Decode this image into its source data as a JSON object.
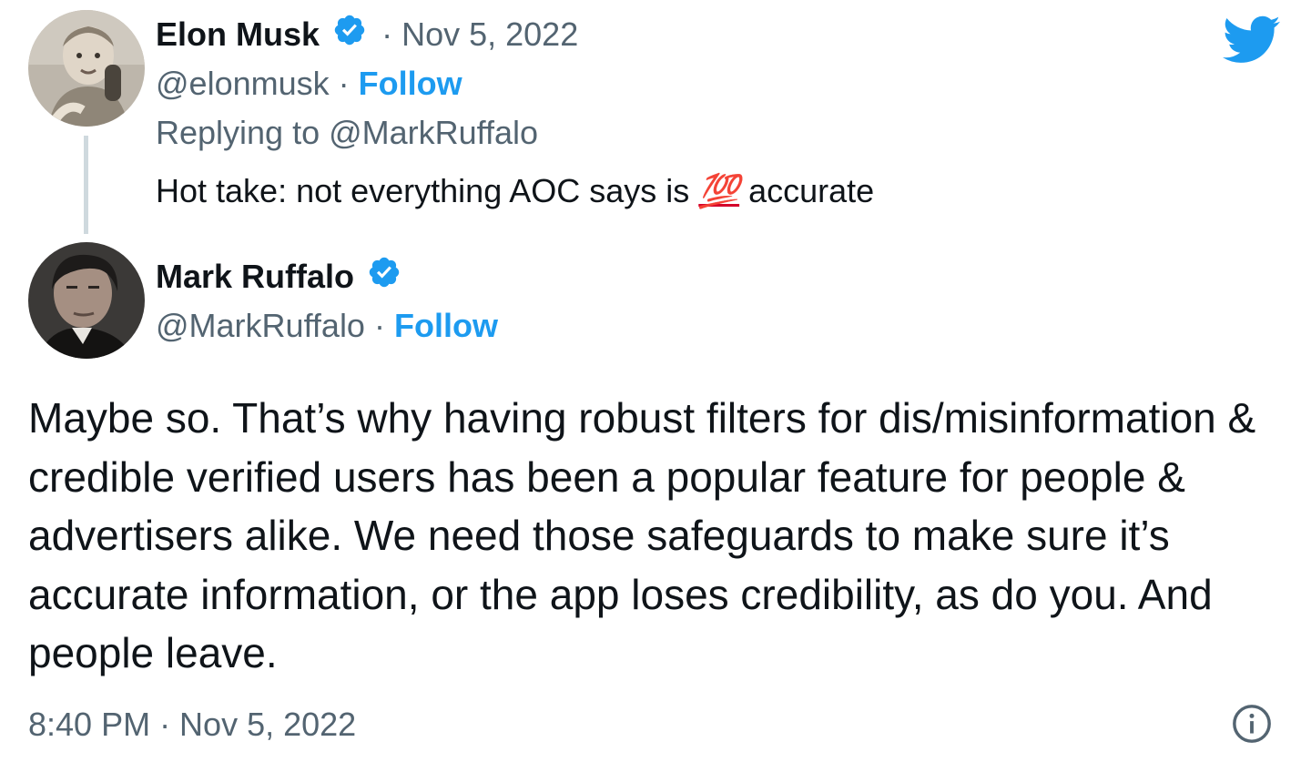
{
  "parent_tweet": {
    "name": "Elon Musk",
    "date_separator": "·",
    "date": "Nov 5, 2022",
    "handle": "@elonmusk",
    "follow_separator": "·",
    "follow_label": "Follow",
    "replying_to": "Replying to @MarkRuffalo",
    "text_before": "Hot take: not everything AOC says is",
    "emoji": "💯",
    "emoji_name": "hundred-points-icon",
    "text_after": "accurate"
  },
  "main_tweet": {
    "name": "Mark Ruffalo",
    "handle": "@MarkRuffalo",
    "follow_separator": "·",
    "follow_label": "Follow",
    "text": "Maybe so. That’s why having robust filters for dis/misinformation & credible verified users has been a popular feature for people & advertisers alike. We need those safeguards to make sure it’s accurate information, or the app loses credibility, as do you. And people leave.",
    "timestamp": "8:40 PM · Nov 5, 2022"
  },
  "icons": {
    "brand": "twitter-bird-icon",
    "verified": "verified-badge-icon",
    "info": "info-icon"
  },
  "colors": {
    "brand_blue": "#1d9bf0",
    "text_primary": "#0f1419",
    "text_secondary": "#536471",
    "thread_line": "#cfd9de"
  }
}
